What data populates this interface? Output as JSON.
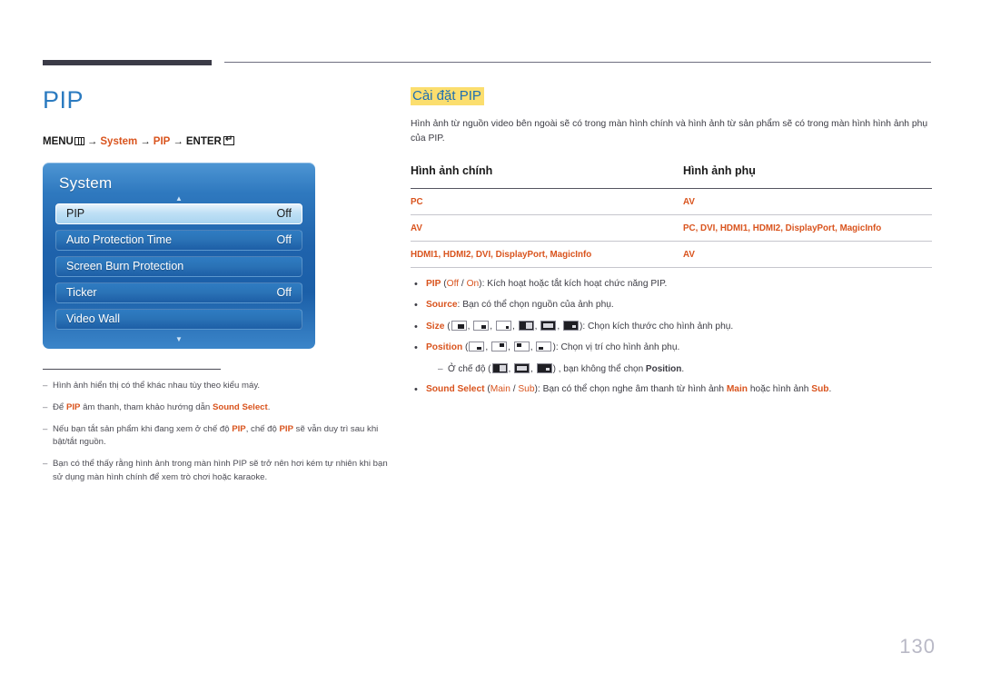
{
  "header": {
    "rule_color": "#3b3b47"
  },
  "left": {
    "page_title": "PIP",
    "menu_path": {
      "menu_label": "MENU",
      "arrow": "→",
      "step1": "System",
      "step2": "PIP",
      "enter_label": "ENTER"
    },
    "osd": {
      "title": "System",
      "up_arrow": "▲",
      "down_arrow": "▼",
      "rows": [
        {
          "label": "PIP",
          "value": "Off",
          "selected": true
        },
        {
          "label": "Auto Protection Time",
          "value": "Off",
          "selected": false
        },
        {
          "label": "Screen Burn Protection",
          "value": "",
          "selected": false
        },
        {
          "label": "Ticker",
          "value": "Off",
          "selected": false
        },
        {
          "label": "Video Wall",
          "value": "",
          "selected": false
        }
      ]
    },
    "notes": [
      {
        "dash": "–",
        "text": "Hình ảnh hiển thị có thể khác nhau tùy theo kiểu máy."
      },
      {
        "dash": "–",
        "text": "Để PIP âm thanh, tham khảo hướng dẫn Sound Select."
      },
      {
        "dash": "–",
        "text": "Nếu bạn tắt sản phẩm khi đang xem ở chế độ PIP, chế độ PIP sẽ vẫn duy trì sau khi bật/tắt nguồn."
      },
      {
        "dash": "–",
        "text": "Bạn có thể thấy rằng hình ảnh trong màn hình PIP sẽ trở nên hơi kém tự nhiên khi bạn sử dụng màn hình chính để xem trò chơi hoặc karaoke."
      }
    ]
  },
  "right": {
    "section_title": "Cài đặt PIP",
    "section_desc": "Hình ảnh từ nguồn video bên ngoài sẽ có trong màn hình chính và hình ảnh từ sản phẩm sẽ có trong màn hình hình ảnh phụ của PIP.",
    "table": {
      "headers": [
        "Hình ảnh chính",
        "Hình ảnh phụ"
      ],
      "rows": [
        {
          "main": "PC",
          "sub": "AV"
        },
        {
          "main": "AV",
          "sub": "PC, DVI, HDMI1, HDMI2, DisplayPort, MagicInfo"
        },
        {
          "main": "HDMI1, HDMI2, DVI, DisplayPort, MagicInfo",
          "sub": "AV"
        }
      ]
    },
    "bullets": {
      "pip": {
        "key": "PIP",
        "paren_open": " (",
        "opt1": "Off",
        "slash": " / ",
        "opt2": "On",
        "paren_close": ")",
        "text": ": Kích hoạt hoặc tắt kích hoạt chức năng PIP."
      },
      "source": {
        "key": "Source",
        "text": ": Bạn có thể chọn nguồn của ảnh phụ."
      },
      "size": {
        "key": "Size",
        "text": "): Chọn kích thước cho hình ảnh phụ."
      },
      "position": {
        "key": "Position",
        "text": "): Chọn vị trí cho hình ảnh phụ."
      },
      "position_note": {
        "dash": "–",
        "text_before": "Ở chế độ (",
        "text_after": ") , bạn không thể chọn ",
        "key": "Position",
        "text_end": "."
      },
      "sound_select": {
        "key": "Sound Select",
        "paren_open": " (",
        "opt1": "Main",
        "slash": " / ",
        "opt2": "Sub",
        "paren_close": ")",
        "text_mid": ": Bạn có thể chọn nghe âm thanh từ hình ảnh ",
        "key2": "Main",
        "text_mid2": " hoặc hình ảnh ",
        "key3": "Sub",
        "text_end": "."
      }
    },
    "icons": {
      "size": [
        "pip-size-icon-1",
        "pip-size-icon-2",
        "pip-size-icon-3",
        "pip-split-icon-1",
        "pip-split-icon-2",
        "pip-split-icon-3"
      ],
      "position": [
        "pip-position-bottom-right-icon",
        "pip-position-top-right-icon",
        "pip-position-top-left-icon",
        "pip-position-bottom-left-icon"
      ],
      "note_icons": [
        "pip-split-icon-1",
        "pip-split-icon-2",
        "pip-split-icon-3"
      ]
    }
  },
  "footer": {
    "page_number": "130"
  },
  "colors": {
    "accent_orange": "#d9541e",
    "title_blue": "#2b7bc0",
    "highlight_yellow": "#fbde6e",
    "osd_blue": "#1f63ac"
  }
}
